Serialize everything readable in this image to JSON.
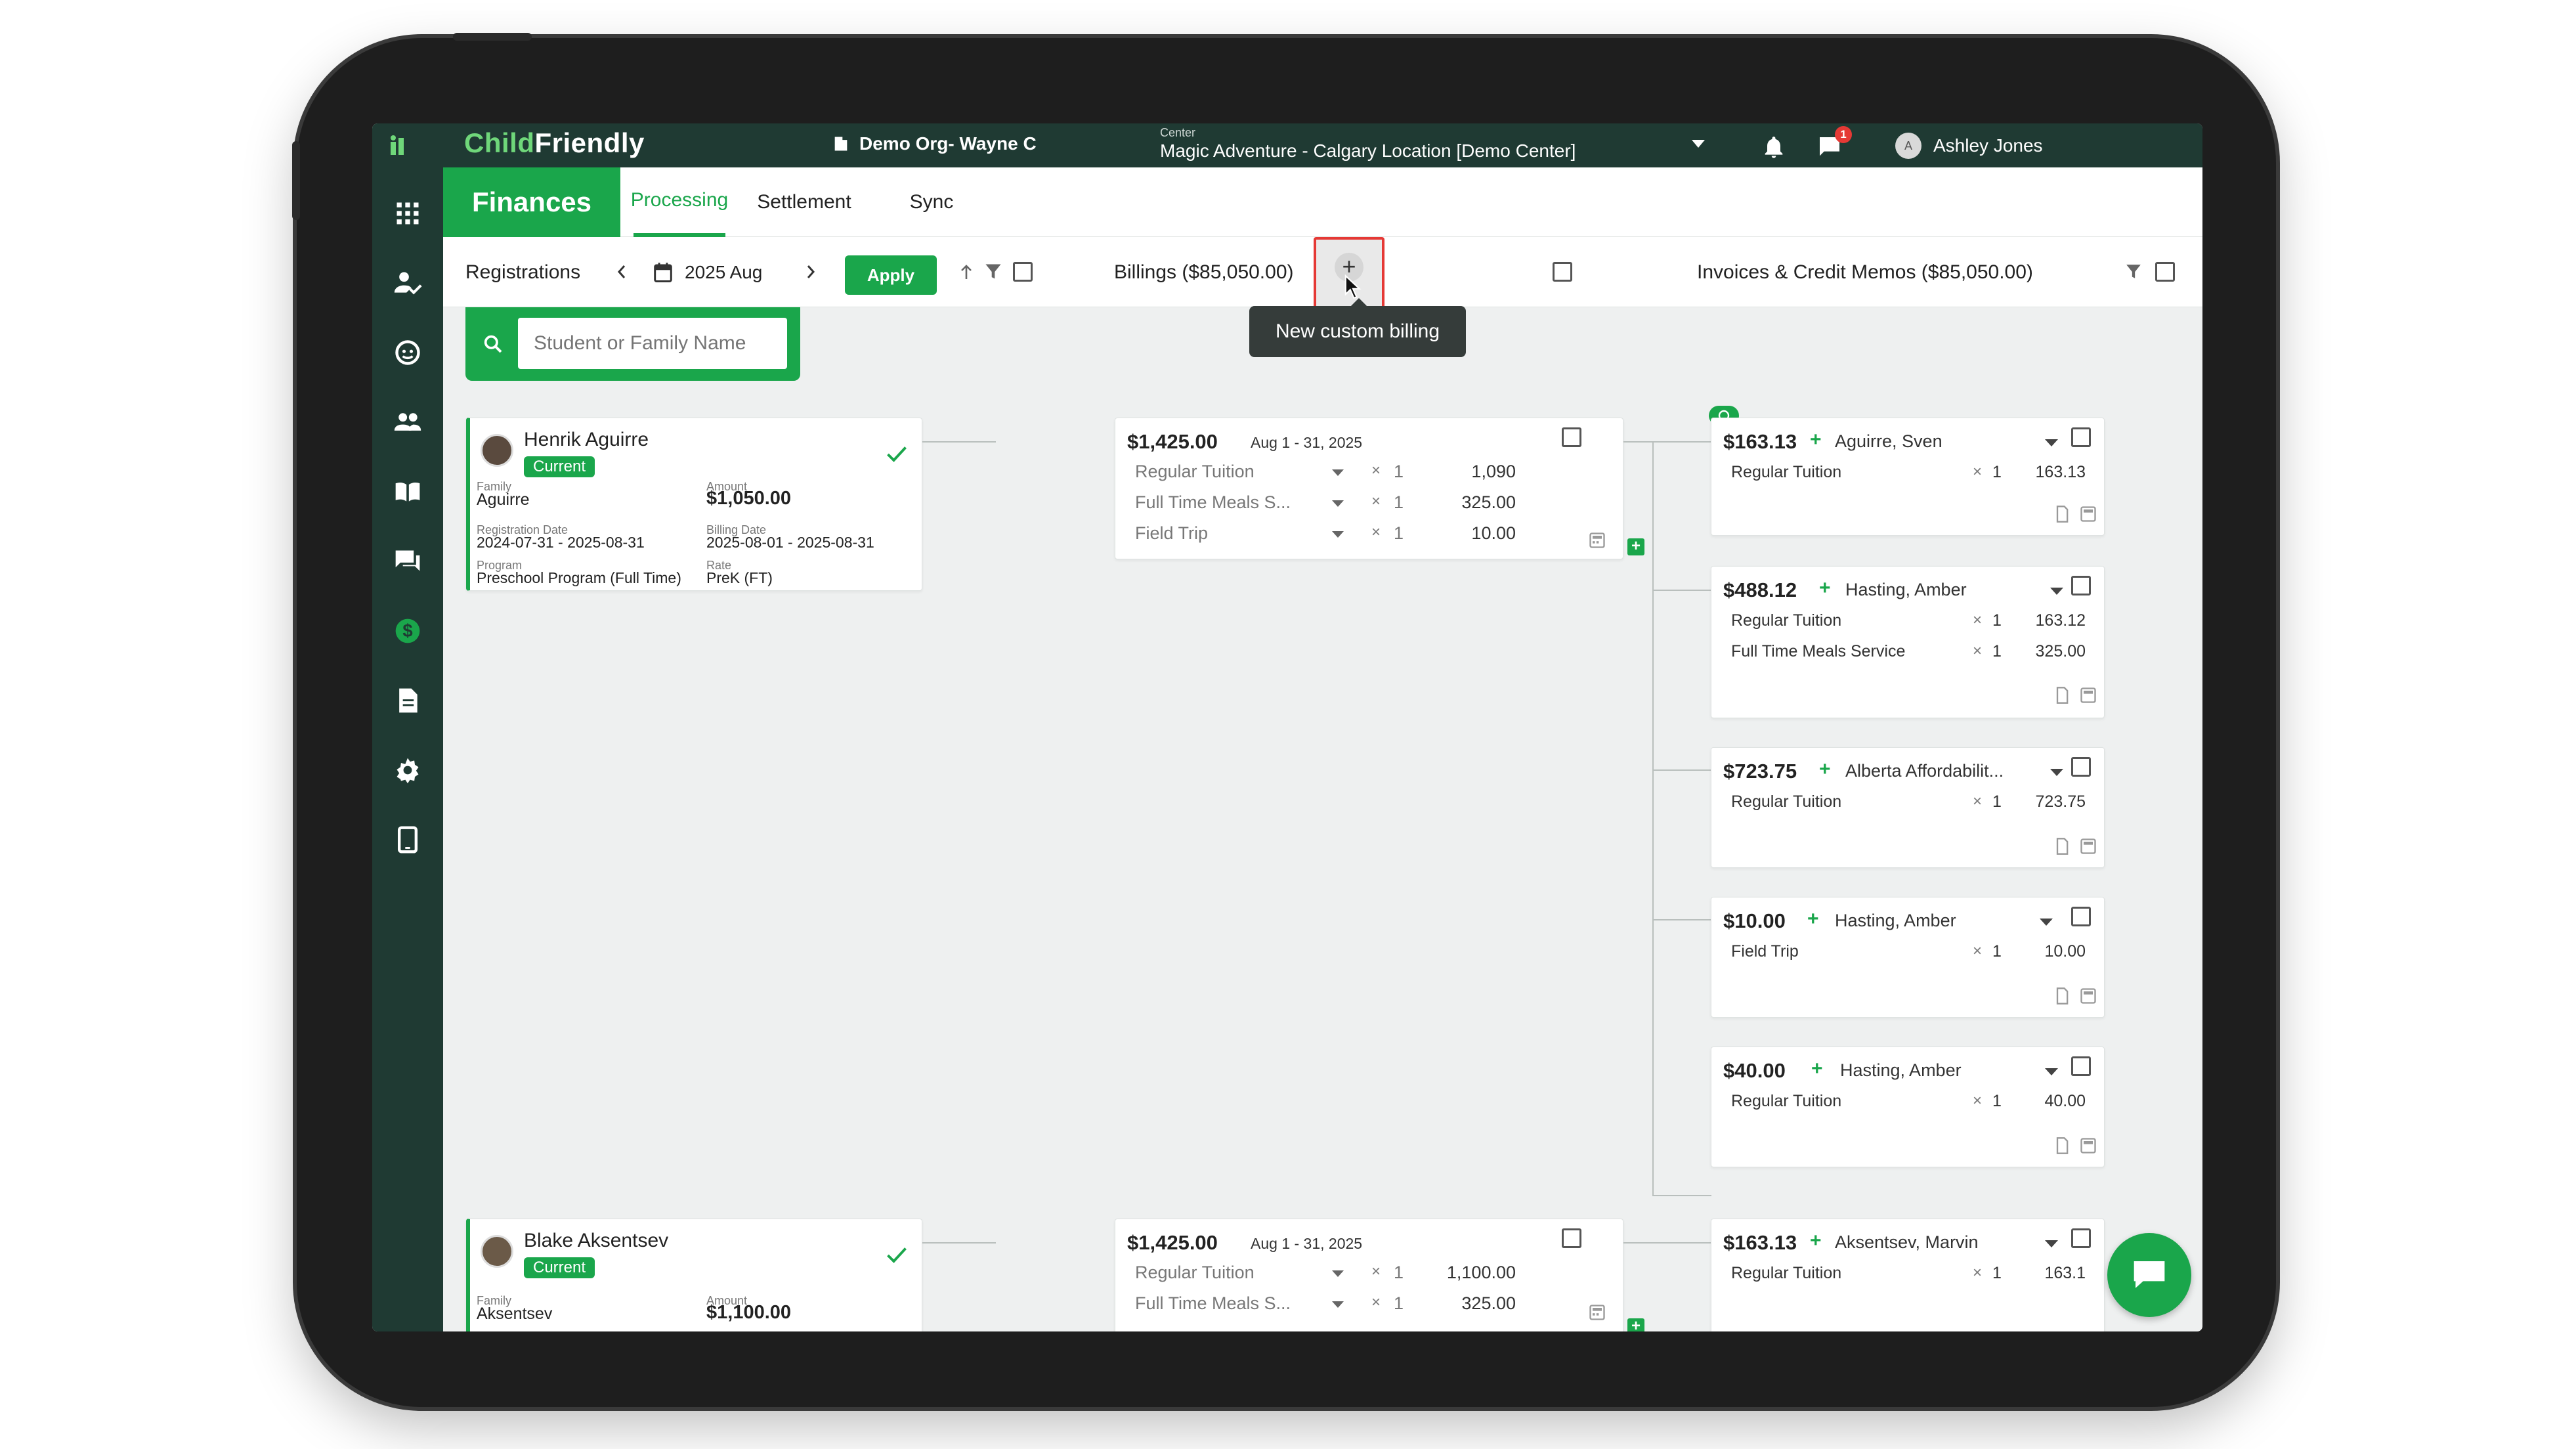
{
  "brand": {
    "child": "Child",
    "friendly": "Friendly"
  },
  "topbar": {
    "org": "Demo Org- Wayne C",
    "center_label": "Center",
    "center_value": "Magic Adventure - Calgary Location [Demo Center]",
    "chat_badge": "1",
    "user_initial": "A",
    "user_name": "Ashley Jones"
  },
  "sidebar": [
    "apps-grid-icon",
    "child-check-icon",
    "face-icon",
    "people-icon",
    "book-icon",
    "chat-icon",
    "dollar-icon",
    "document-icon",
    "gear-icon",
    "tablet-icon"
  ],
  "tabs": {
    "finances": "Finances",
    "processing": "Processing",
    "settlement": "Settlement",
    "sync": "Sync"
  },
  "toolbar": {
    "registrations": "Registrations",
    "month": "2025 Aug",
    "apply": "Apply",
    "billings": "Billings ($85,050.00)",
    "plus": "+",
    "invoices": "Invoices & Credit Memos ($85,050.00)",
    "tooltip": "New custom billing"
  },
  "search": {
    "placeholder": "Student or Family Name"
  },
  "registrations": [
    {
      "name": "Henrik Aguirre",
      "status": "Current",
      "family_label": "Family",
      "family": "Aguirre",
      "amount_label": "Amount",
      "amount": "$1,050.00",
      "reg_date_label": "Registration Date",
      "reg_date": "2024-07-31 - 2025-08-31",
      "bill_date_label": "Billing Date",
      "bill_date": "2025-08-01 - 2025-08-31",
      "program_label": "Program",
      "program": "Preschool Program (Full Time)",
      "rate_label": "Rate",
      "rate": "PreK (FT)"
    },
    {
      "name": "Blake Aksentsev",
      "status": "Current",
      "family_label": "Family",
      "family": "Aksentsev",
      "amount_label": "Amount",
      "amount": "$1,100.00"
    }
  ],
  "billings": [
    {
      "amount": "$1,425.00",
      "dates": "Aug 1 - 31, 2025",
      "lines": [
        {
          "item": "Regular Tuition",
          "x": "×",
          "qty": "1",
          "amt": "1,090"
        },
        {
          "item": "Full Time Meals S...",
          "x": "×",
          "qty": "1",
          "amt": "325.00"
        },
        {
          "item": "Field Trip",
          "x": "×",
          "qty": "1",
          "amt": "10.00"
        }
      ]
    },
    {
      "amount": "$1,425.00",
      "dates": "Aug 1 - 31, 2025",
      "lines": [
        {
          "item": "Regular Tuition",
          "x": "×",
          "qty": "1",
          "amt": "1,100.00"
        },
        {
          "item": "Full Time Meals S...",
          "x": "×",
          "qty": "1",
          "amt": "325.00"
        }
      ]
    }
  ],
  "invoices": [
    {
      "amount": "$163.13",
      "plus": "+",
      "name": "Aguirre, Sven",
      "lines": [
        {
          "item": "Regular Tuition",
          "x": "×",
          "qty": "1",
          "amt": "163.13"
        }
      ]
    },
    {
      "amount": "$488.12",
      "plus": "+",
      "name": "Hasting, Amber",
      "lines": [
        {
          "item": "Regular Tuition",
          "x": "×",
          "qty": "1",
          "amt": "163.12"
        },
        {
          "item": "Full Time Meals Service",
          "x": "×",
          "qty": "1",
          "amt": "325.00"
        }
      ]
    },
    {
      "amount": "$723.75",
      "plus": "+",
      "name": "Alberta Affordabilit...",
      "lines": [
        {
          "item": "Regular Tuition",
          "x": "×",
          "qty": "1",
          "amt": "723.75"
        }
      ]
    },
    {
      "amount": "$10.00",
      "plus": "+",
      "name": "Hasting, Amber",
      "lines": [
        {
          "item": "Field Trip",
          "x": "×",
          "qty": "1",
          "amt": "10.00"
        }
      ]
    },
    {
      "amount": "$40.00",
      "plus": "+",
      "name": "Hasting, Amber",
      "lines": [
        {
          "item": "Regular Tuition",
          "x": "×",
          "qty": "1",
          "amt": "40.00"
        }
      ]
    },
    {
      "amount": "$163.13",
      "plus": "+",
      "name": "Aksentsev, Marvin",
      "lines": [
        {
          "item": "Regular Tuition",
          "x": "×",
          "qty": "1",
          "amt": "163.1"
        }
      ]
    }
  ],
  "colors": {
    "accent": "#1aa64b",
    "topbar": "#1f3a33",
    "alert": "#e53935"
  }
}
